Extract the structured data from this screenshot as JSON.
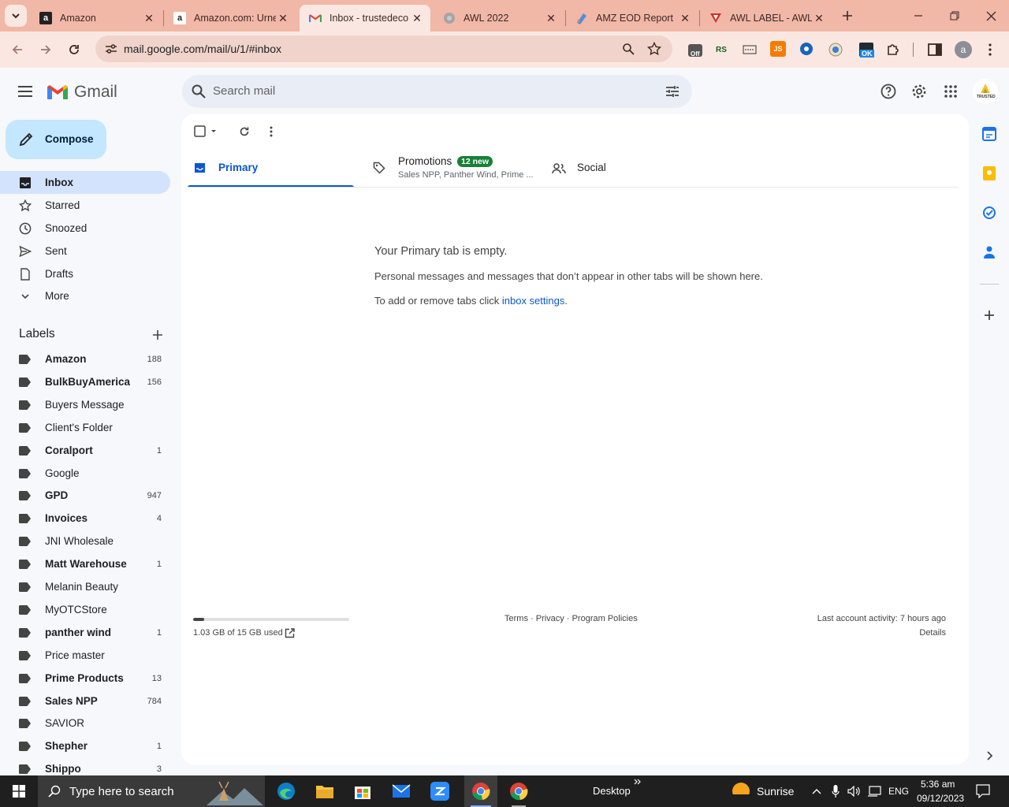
{
  "browser": {
    "tabs": [
      {
        "title": "Amazon",
        "favicon": "amazon-icon"
      },
      {
        "title": "Amazon.com: Urne",
        "favicon": "amazon-icon"
      },
      {
        "title": "Inbox - trustedeco",
        "favicon": "gmail-icon",
        "active": true
      },
      {
        "title": "AWL 2022",
        "favicon": "globe-icon"
      },
      {
        "title": "AMZ EOD Report",
        "favicon": "sheets-icon"
      },
      {
        "title": "AWL LABEL - AWL",
        "favicon": "red-logo-icon"
      }
    ],
    "url": "mail.google.com/mail/u/1/#inbox",
    "profile_initial": "a",
    "extension_badges": {
      "off": "Off",
      "ok": "OK",
      "rs": "RS",
      "js": "JS"
    }
  },
  "gmail": {
    "app_name": "Gmail",
    "search_placeholder": "Search mail",
    "compose_label": "Compose",
    "account_logo_text": "TRUSTED",
    "nav": [
      {
        "label": "Inbox",
        "icon": "inbox-icon",
        "selected": true
      },
      {
        "label": "Starred",
        "icon": "star-icon"
      },
      {
        "label": "Snoozed",
        "icon": "clock-icon"
      },
      {
        "label": "Sent",
        "icon": "send-icon"
      },
      {
        "label": "Drafts",
        "icon": "draft-icon"
      },
      {
        "label": "More",
        "icon": "chevron-down-icon"
      }
    ],
    "labels_heading": "Labels",
    "labels": [
      {
        "name": "Amazon",
        "count": "188",
        "bold": true
      },
      {
        "name": "BulkBuyAmerica",
        "count": "156",
        "bold": true
      },
      {
        "name": "Buyers Message",
        "count": "",
        "bold": false
      },
      {
        "name": "Client's Folder",
        "count": "",
        "bold": false
      },
      {
        "name": "Coralport",
        "count": "1",
        "bold": true
      },
      {
        "name": "Google",
        "count": "",
        "bold": false
      },
      {
        "name": "GPD",
        "count": "947",
        "bold": true
      },
      {
        "name": "Invoices",
        "count": "4",
        "bold": true
      },
      {
        "name": "JNI Wholesale",
        "count": "",
        "bold": false
      },
      {
        "name": "Matt Warehouse",
        "count": "1",
        "bold": true
      },
      {
        "name": "Melanin Beauty",
        "count": "",
        "bold": false
      },
      {
        "name": "MyOTCStore",
        "count": "",
        "bold": false
      },
      {
        "name": "panther wind",
        "count": "1",
        "bold": true
      },
      {
        "name": "Price master",
        "count": "",
        "bold": false
      },
      {
        "name": "Prime Products",
        "count": "13",
        "bold": true
      },
      {
        "name": "Sales NPP",
        "count": "784",
        "bold": true
      },
      {
        "name": "SAVIOR",
        "count": "",
        "bold": false
      },
      {
        "name": "Shepher",
        "count": "1",
        "bold": true
      },
      {
        "name": "Shippo",
        "count": "3",
        "bold": true
      }
    ],
    "tabs": {
      "primary": "Primary",
      "promotions": "Promotions",
      "promotions_badge": "12 new",
      "promotions_snippet": "Sales NPP, Panther Wind, Prime ...",
      "social": "Social"
    },
    "empty": {
      "title": "Your Primary tab is empty.",
      "line1": "Personal messages and messages that don’t appear in other tabs will be shown here.",
      "line2_prefix": "To add or remove tabs click ",
      "line2_link": "inbox settings",
      "line2_suffix": "."
    },
    "footer": {
      "storage_text": "1.03 GB of 15 GB used",
      "storage_fraction": 0.069,
      "terms": "Terms",
      "privacy": "Privacy",
      "policies": "Program Policies",
      "sep": " · ",
      "activity": "Last account activity: 7 hours ago",
      "details": "Details"
    }
  },
  "taskbar": {
    "search_placeholder": "Type here to search",
    "desktop_label": "Desktop",
    "weather": "Sunrise",
    "language": "ENG",
    "time": "5:36 am",
    "date": "09/12/2023"
  },
  "colors": {
    "tabstrip": "#f1b7a7",
    "toolbar": "#fbe7e1",
    "accent_blue": "#0b57d0",
    "nav_selected": "#d3e3fd",
    "compose_bg": "#c2e7ff",
    "badge_green": "#188038"
  }
}
